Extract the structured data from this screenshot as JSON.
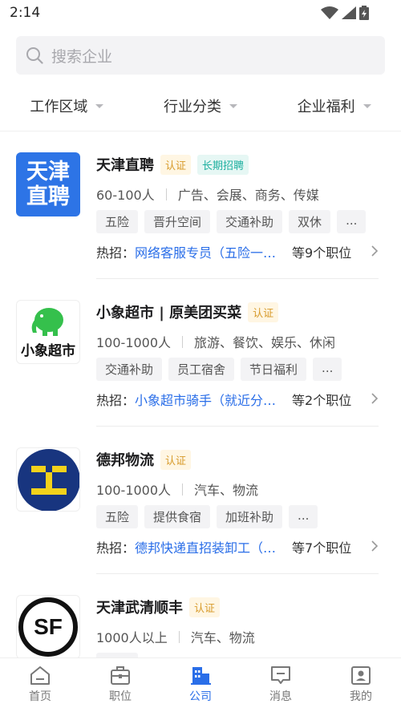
{
  "status": {
    "time": "2:14"
  },
  "search": {
    "placeholder": "搜索企业"
  },
  "filters": [
    "工作区域",
    "行业分类",
    "企业福利"
  ],
  "companies": [
    {
      "name": "天津直聘",
      "badges": [
        "认证",
        "长期招聘"
      ],
      "size": "60-100人",
      "industry": "广告、会展、商务、传媒",
      "benefits": [
        "五险",
        "晋升空间",
        "交通补助",
        "双休",
        "..."
      ],
      "hot_label": "热招：",
      "hot_job": "网络客服专员（五险一金…",
      "hot_count": "等9个职位",
      "logo_text": [
        "天津",
        "直聘"
      ]
    },
    {
      "name": "小象超市 | 原美团买菜",
      "badges": [
        "认证"
      ],
      "size": "100-1000人",
      "industry": "旅游、餐饮、娱乐、休闲",
      "benefits": [
        "交通补助",
        "员工宿舍",
        "节日福利",
        "..."
      ],
      "hot_label": "热招：",
      "hot_job": "小象超市骑手（就近分配…",
      "hot_count": "等2个职位",
      "logo_text": [
        "小象超市"
      ]
    },
    {
      "name": "德邦物流",
      "badges": [
        "认证"
      ],
      "size": "100-1000人",
      "industry": "汽车、物流",
      "benefits": [
        "五险",
        "提供食宿",
        "加班补助",
        "..."
      ],
      "hot_label": "热招：",
      "hot_job": "德邦快递直招装卸工（提…",
      "hot_count": "等7个职位"
    },
    {
      "name": "天津武清顺丰",
      "badges": [
        "认证"
      ],
      "size": "1000人以上",
      "industry": "汽车、物流",
      "benefits": [],
      "hot_label": "",
      "hot_job": "",
      "hot_count": "",
      "logo_text": [
        "SF"
      ]
    }
  ],
  "tabs": [
    {
      "label": "首页",
      "icon": "home-icon"
    },
    {
      "label": "职位",
      "icon": "briefcase-icon"
    },
    {
      "label": "公司",
      "icon": "building-icon",
      "active": true
    },
    {
      "label": "消息",
      "icon": "message-icon"
    },
    {
      "label": "我的",
      "icon": "profile-icon"
    }
  ],
  "colors": {
    "accent": "#2a6ee8",
    "cert": "#d79a2a",
    "long_term": "#1fb0a0"
  }
}
